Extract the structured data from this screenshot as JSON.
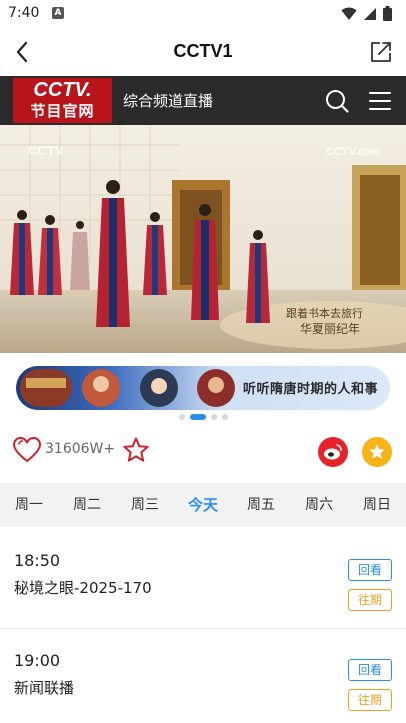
{
  "status_bar": {
    "time": "7:40",
    "notification_letter": "A"
  },
  "nav": {
    "title": "CCTV1"
  },
  "channel": {
    "logo_line1": "CCTV.",
    "logo_line2": "节目官网",
    "subtitle": "综合频道直播"
  },
  "video": {
    "watermark_left": "CCTV",
    "watermark_right": "CCTV.com",
    "caption_line1": "跟着书本去旅行",
    "caption_line2": "华夏丽纪年"
  },
  "banner": {
    "text": "听听隋唐时期的人和事",
    "active_dot": 1,
    "dot_count": 4
  },
  "actions": {
    "like_count": "31606W+"
  },
  "days": [
    "周一",
    "周二",
    "周三",
    "今天",
    "周五",
    "周六",
    "周日"
  ],
  "active_day": 3,
  "programs": [
    {
      "time": "18:50",
      "title": "秘境之眼-2025-170",
      "replay_label": "回看",
      "past_label": "往期"
    },
    {
      "time": "19:00",
      "title": "新闻联播",
      "replay_label": "回看",
      "past_label": "往期"
    }
  ],
  "colors": {
    "accent": "#2a8ef0",
    "brand_red": "#b8141b",
    "header_bg": "#2b2b2b",
    "past_orange": "#f0a020",
    "weibo_red": "#e6232b",
    "collect_yellow": "#f6b418"
  }
}
